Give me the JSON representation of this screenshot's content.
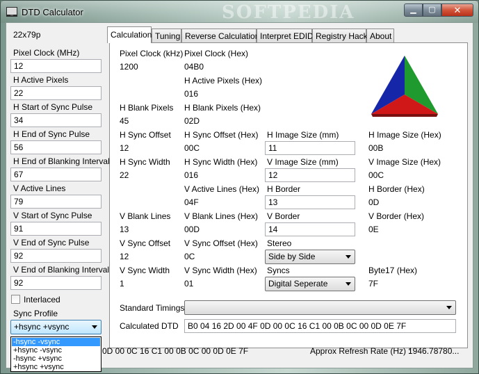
{
  "window": {
    "title": "DTD Calculator",
    "watermark": "SOFTPEDIA",
    "controls": {
      "minimize": "▁",
      "maximize": "▢",
      "close": "✕"
    }
  },
  "left": {
    "resolution": "22x79p",
    "fields": [
      {
        "label": "Pixel Clock (MHz)",
        "value": "12"
      },
      {
        "label": "H Active Pixels",
        "value": "22"
      },
      {
        "label": "H Start of Sync Pulse",
        "value": "34"
      },
      {
        "label": "H End of Sync Pulse",
        "value": "56"
      },
      {
        "label": "H End of Blanking Interval",
        "value": "67"
      },
      {
        "label": "V Active Lines",
        "value": "79"
      },
      {
        "label": "V Start of Sync Pulse",
        "value": "91"
      },
      {
        "label": "V End of Sync Pulse",
        "value": "92"
      },
      {
        "label": "V End of Blanking Interval",
        "value": "92"
      }
    ],
    "interlaced_label": "Interlaced",
    "sync_profile_label": "Sync Profile",
    "sync_profile_value": "+hsync +vsync",
    "sync_profile_options": [
      "-hsync -vsync",
      "+hsync -vsync",
      "-hsync +vsync",
      "+hsync +vsync"
    ]
  },
  "tabs": [
    "Calculation",
    "Tuning",
    "Reverse Calculation",
    "Interpret EDID",
    "Registry Hack",
    "About"
  ],
  "calc": {
    "pixel_clock_khz_label": "Pixel Clock (kHz)",
    "pixel_clock_khz": "1200",
    "pixel_clock_hex_label": "Pixel Clock (Hex)",
    "pixel_clock_hex": "04B0",
    "h_active_hex_label": "H Active Pixels (Hex)",
    "h_active_hex": "016",
    "h_blank_label": "H Blank Pixels",
    "h_blank": "45",
    "h_blank_hex_label": "H Blank Pixels (Hex)",
    "h_blank_hex": "02D",
    "h_sync_offset_label": "H Sync Offset",
    "h_sync_offset": "12",
    "h_sync_offset_hex_label": "H Sync Offset (Hex)",
    "h_sync_offset_hex": "00C",
    "h_image_mm_label": "H Image Size (mm)",
    "h_image_mm": "11",
    "h_image_hex_label": "H Image Size (Hex)",
    "h_image_hex": "00B",
    "h_sync_width_label": "H Sync Width",
    "h_sync_width": "22",
    "h_sync_width_hex_label": "H Sync Width (Hex)",
    "h_sync_width_hex": "016",
    "v_image_mm_label": "V Image Size (mm)",
    "v_image_mm": "12",
    "v_image_hex_label": "V Image Size (Hex)",
    "v_image_hex": "00C",
    "v_active_hex_label": "V Active Lines (Hex)",
    "v_active_hex": "04F",
    "h_border_label": "H Border",
    "h_border": "13",
    "h_border_hex_label": "H Border (Hex)",
    "h_border_hex": "0D",
    "v_blank_label": "V Blank Lines",
    "v_blank": "13",
    "v_blank_hex_label": "V Blank Lines (Hex)",
    "v_blank_hex": "00D",
    "v_border_label": "V Border",
    "v_border": "14",
    "v_border_hex_label": "V Border (Hex)",
    "v_border_hex": "0E",
    "v_sync_offset_label": "V Sync Offset",
    "v_sync_offset": "12",
    "v_sync_offset_hex_label": "V Sync Offset (Hex)",
    "v_sync_offset_hex": "0C",
    "stereo_label": "Stereo",
    "stereo_value": "Side by Side",
    "v_sync_width_label": "V Sync Width",
    "v_sync_width": "1",
    "v_sync_width_hex_label": "V Sync Width (Hex)",
    "v_sync_width_hex": "01",
    "syncs_label": "Syncs",
    "syncs_value": "Digital Seperate",
    "byte17_label": "Byte17 (Hex)",
    "byte17": "7F",
    "standard_timings_label": "Standard Timings",
    "standard_timings_value": "",
    "calculated_dtd_label": "Calculated DTD",
    "calculated_dtd": "B0 04 16 2D 00 4F 0D 00 0C 16 C1 00 0B 0C 00 0D 0E 7F"
  },
  "status": {
    "dtd_tail": "0D  00  0C  16  C1  00  0B  0C  00  0D  0E  7F",
    "refresh_label": "Approx Refresh Rate (Hz) :",
    "refresh_value": "1946.78780..."
  },
  "colors": {
    "logo_red": "#d01818",
    "logo_green": "#1e9a2e",
    "logo_blue": "#1626a8",
    "selection": "#3399ff"
  }
}
